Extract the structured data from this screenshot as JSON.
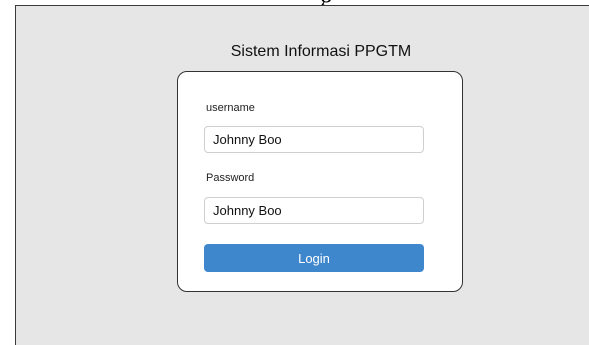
{
  "app": {
    "title": "Sistem Informasi PPGTM",
    "top_glyph": "g"
  },
  "form": {
    "username": {
      "label": "username",
      "value": "Johnny Boo"
    },
    "password": {
      "label": "Password",
      "value": "Johnny Boo"
    },
    "login_label": "Login"
  },
  "colors": {
    "page_background": "#e6e6e6",
    "card_background": "#ffffff",
    "button": "#3f87cc",
    "button_text": "#ffffff"
  }
}
